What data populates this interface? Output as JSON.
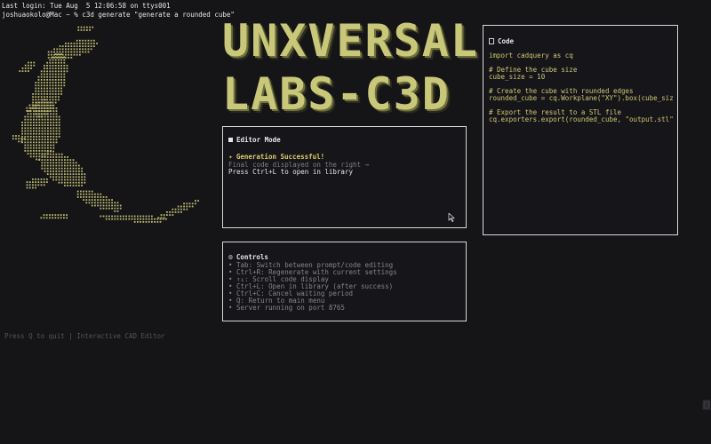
{
  "terminal": {
    "login_line": "Last login: Tue Aug  5 12:06:58 on ttys001",
    "prompt_line": "joshuaokolo@Mac ~ % c3d generate \"generate a rounded cube\""
  },
  "banner": {
    "line1": "UNXVERSAL",
    "line2": "LABS-C3D"
  },
  "editor": {
    "title": "Editor Mode",
    "success": "Generation Successful!",
    "line1": "Final code displayed on the right →",
    "line2": "Press Ctrl+L to open in library"
  },
  "controls": {
    "title": "Controls",
    "items": [
      "• Tab: Switch between prompt/code editing",
      "• Ctrl+R: Regenerate with current settings",
      "• ↑↓: Scroll code display",
      "• Ctrl+L: Open in library (after success)",
      "• Ctrl+C: Cancel waiting period",
      "• Q: Return to main menu",
      "• Server running on port 8765"
    ]
  },
  "code": {
    "title": "Code",
    "lines": [
      "import cadquery as cq",
      "",
      "# Define the cube size",
      "cube_size = 10",
      "",
      "# Create the cube with rounded edges",
      "rounded_cube = cq.Workplane(\"XY\").box(cube_size, cube_s…",
      "",
      "# Export the result to a STL file",
      "cq.exporters.export(rounded_cube, \"output.stl\")"
    ]
  },
  "footer": "Press Q to quit | Interactive CAD Editor",
  "icons": {
    "editor": "square-icon",
    "success": "party-popper-icon",
    "controls": "gear-icon",
    "code": "document-icon",
    "art": "dolphin-ascii-art"
  },
  "colors": {
    "background": "#151518",
    "accent": "#c9c87a",
    "code_text": "#cfc773",
    "success": "#d9c96a"
  }
}
